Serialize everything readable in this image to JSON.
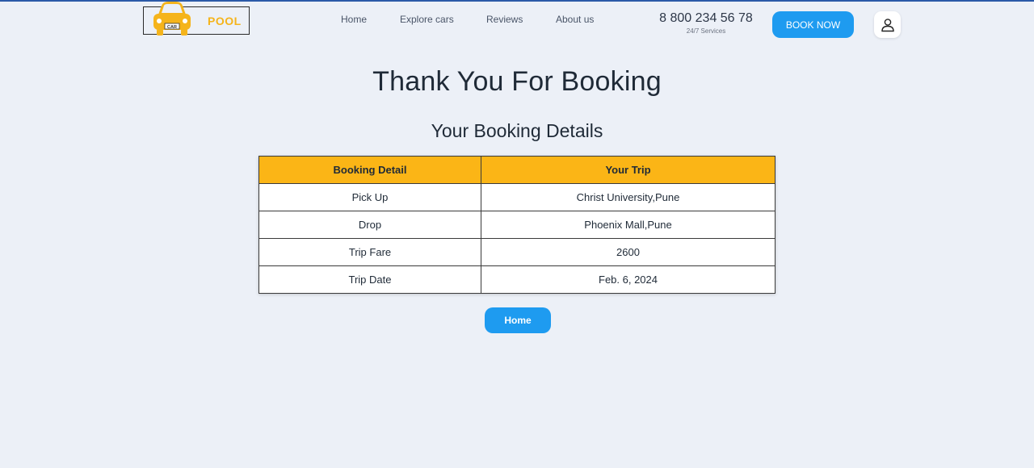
{
  "colors": {
    "background": "#ecf0f7",
    "accent_blue": "#1e9bf0",
    "brand_yellow": "#fbb516",
    "top_bar": "#2b5aa8"
  },
  "header": {
    "logo": {
      "icon": "taxi-car-icon",
      "plate_text": "CAR",
      "text": "POOL"
    },
    "nav": [
      {
        "label": "Home"
      },
      {
        "label": "Explore cars"
      },
      {
        "label": "Reviews"
      },
      {
        "label": "About us"
      }
    ],
    "phone": {
      "number": "8 800 234 56 78",
      "subtitle": "24/7 Services"
    },
    "book_now_label": "BOOK NOW",
    "user_icon": "user-icon"
  },
  "main": {
    "title": "Thank You For Booking",
    "subtitle": "Your Booking Details",
    "table": {
      "headers": [
        "Booking Detail",
        "Your Trip"
      ],
      "rows": [
        [
          "Pick Up",
          "Christ University,Pune"
        ],
        [
          "Drop",
          "Phoenix Mall,Pune"
        ],
        [
          "Trip Fare",
          "2600"
        ],
        [
          "Trip Date",
          "Feb. 6, 2024"
        ]
      ]
    },
    "home_button_label": "Home"
  }
}
